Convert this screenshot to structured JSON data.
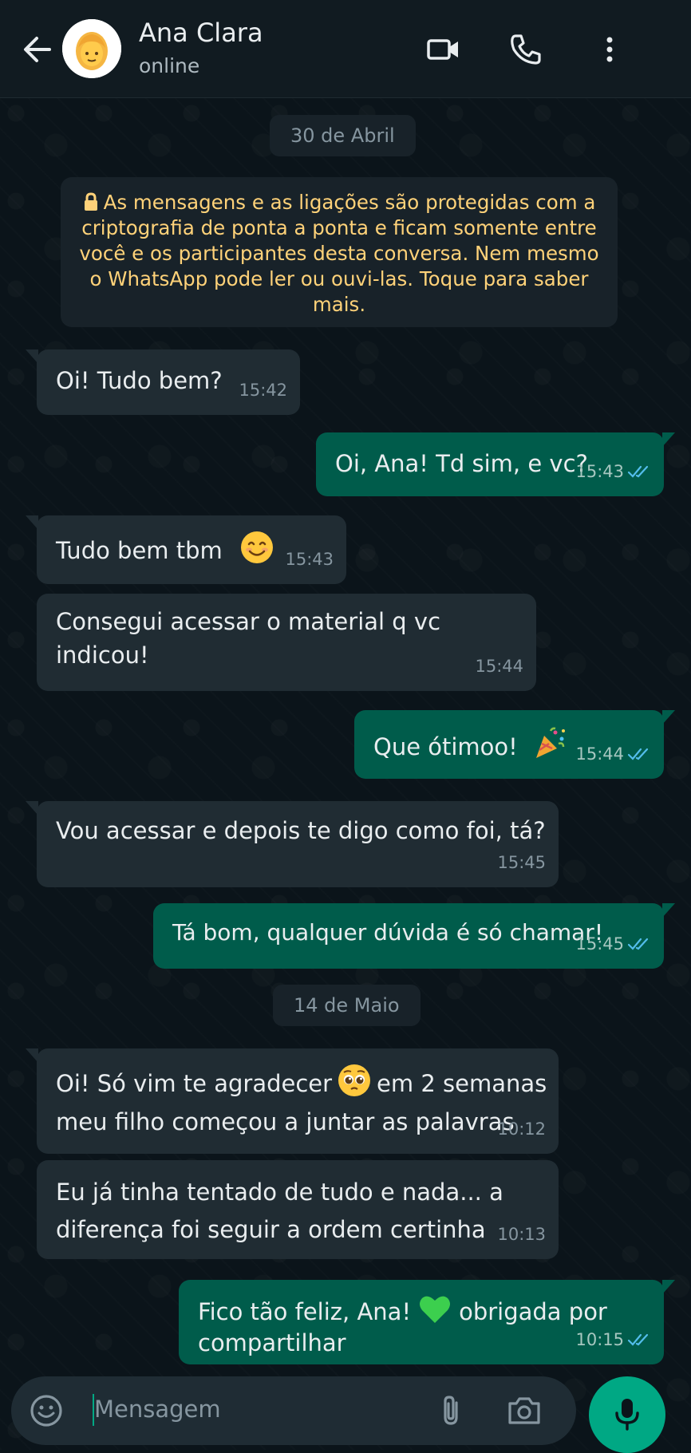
{
  "header": {
    "contact_name": "Ana Clara",
    "status": "online"
  },
  "dates": [
    "30 de Abril",
    "14 de Maio"
  ],
  "encryption_notice": "As mensagens e as ligações são protegidas com a criptografia de ponta a ponta e ficam somente entre você e os participantes desta conversa. Nem mesmo o WhatsApp pode ler ou ouvi-las. Toque para saber mais.",
  "messages": [
    {
      "dir": "in",
      "text": "Oi! Tudo bem?",
      "time": "15:42"
    },
    {
      "dir": "out",
      "text": "Oi, Ana! Td sim, e vc?",
      "time": "15:43",
      "status": "read"
    },
    {
      "dir": "in",
      "text": "Tudo bem tbm",
      "emoji": "smiling-face",
      "time": "15:43"
    },
    {
      "dir": "in",
      "text_line1": "Consegui acessar o material q vc",
      "text_line2": "indicou!",
      "time": "15:44"
    },
    {
      "dir": "out",
      "text": "Que ótimoo!",
      "emoji": "party-popper",
      "time": "15:44",
      "status": "read"
    },
    {
      "dir": "in",
      "text": "Vou acessar e depois te digo como foi, tá?",
      "time": "15:45"
    },
    {
      "dir": "out",
      "text": "Tá bom, qualquer dúvida é só chamar!",
      "time": "15:45",
      "status": "read"
    },
    {
      "dir": "in",
      "text_before": "Oi! Só vim te agradecer",
      "emoji": "pleading-face",
      "text_after": "em 2 semanas",
      "text_line2": "meu filho começou a juntar as palavras",
      "time": "10:12"
    },
    {
      "dir": "in",
      "text_line1": "Eu já tinha tentado de tudo e nada... a",
      "text_line2": "diferença foi seguir a ordem certinha",
      "time": "10:13"
    },
    {
      "dir": "out",
      "text_before": "Fico tão feliz, Ana!",
      "emoji": "green-heart",
      "text_after": "obrigada por",
      "text_line2": "compartilhar",
      "time": "10:15",
      "status": "read"
    }
  ],
  "composer": {
    "placeholder": "Mensagem"
  },
  "colors": {
    "background": "#0b141a",
    "header": "#111b21",
    "incoming_bubble": "#202c33",
    "outgoing_bubble": "#005c4b",
    "read_ticks": "#53bdeb",
    "notice_text": "#ffd279",
    "accent": "#00a884"
  }
}
